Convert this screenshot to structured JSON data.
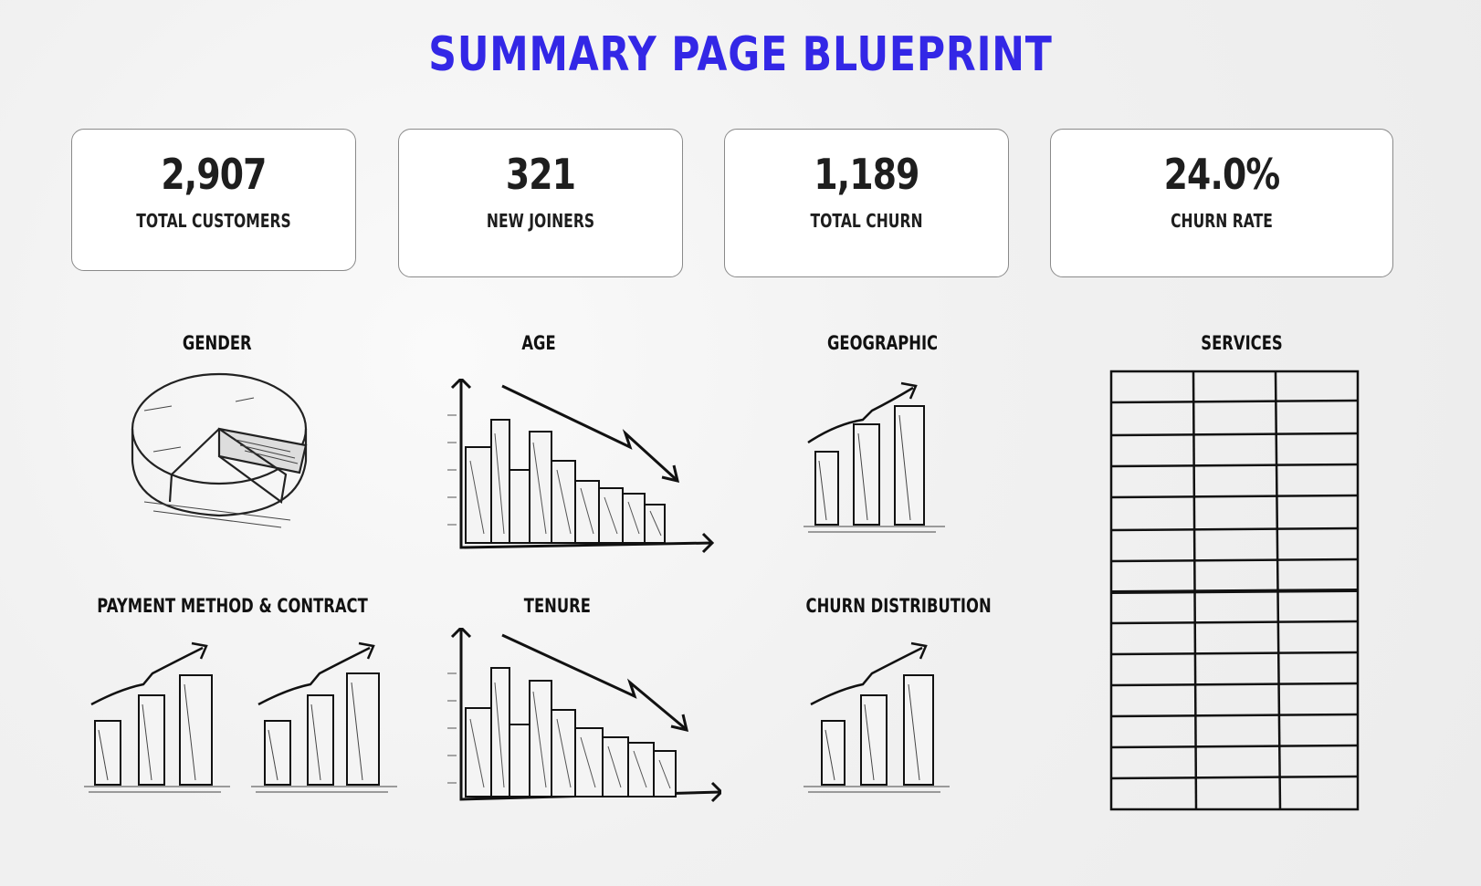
{
  "title": "SUMMARY PAGE BLUEPRINT",
  "kpis": [
    {
      "value": "2,907",
      "label": "TOTAL CUSTOMERS"
    },
    {
      "value": "321",
      "label": "NEW JOINERS"
    },
    {
      "value": "1,189",
      "label": "TOTAL CHURN"
    },
    {
      "value": "24.0%",
      "label": "CHURN RATE"
    }
  ],
  "sections": {
    "gender": "GENDER",
    "age": "AGE",
    "geographic": "GEOGRAPHIC",
    "services": "SERVICES",
    "payment": "PAYMENT METHOD & CONTRACT",
    "tenure": "TENURE",
    "churn_distribution": "CHURN DISTRIBUTION"
  },
  "icons": {
    "gender": "pie-chart-sketch-icon",
    "age": "bar-chart-declining-sketch-icon",
    "geographic": "bar-chart-rising-sketch-icon",
    "services": "table-sketch-icon",
    "payment": "bar-chart-rising-sketch-icon",
    "tenure": "bar-chart-declining-sketch-icon",
    "churn_distribution": "bar-chart-rising-sketch-icon"
  },
  "colors": {
    "title": "#3327e6",
    "text": "#1e1e1e"
  }
}
